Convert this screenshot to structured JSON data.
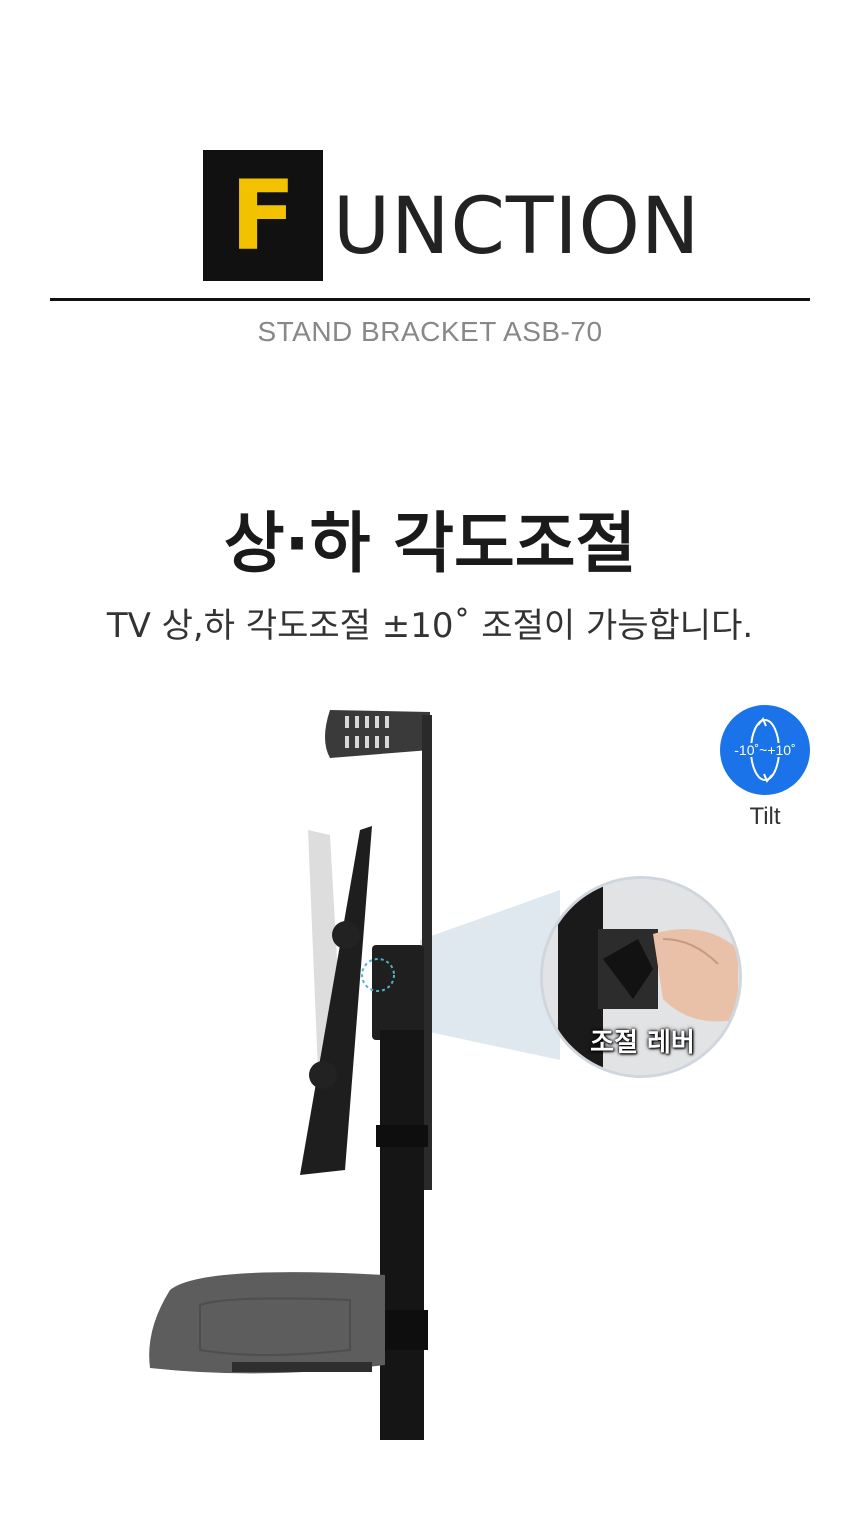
{
  "header": {
    "logo_letter": "F",
    "logo_rest": "UNCTION",
    "subtitle": "STAND BRACKET ASB-70"
  },
  "feature": {
    "title": "상·하 각도조절",
    "description": "TV 상,하 각도조절 ±10˚ 조절이 가능합니다."
  },
  "tilt": {
    "range": "-10˚~+10˚",
    "label": "Tilt",
    "icon": "tilt-rotate-icon"
  },
  "callout": {
    "label": "조절 레버"
  },
  "colors": {
    "accent_yellow": "#f2c200",
    "badge_blue": "#1a73e8",
    "text_dark": "#1a1a1a",
    "subtitle_gray": "#888888"
  }
}
